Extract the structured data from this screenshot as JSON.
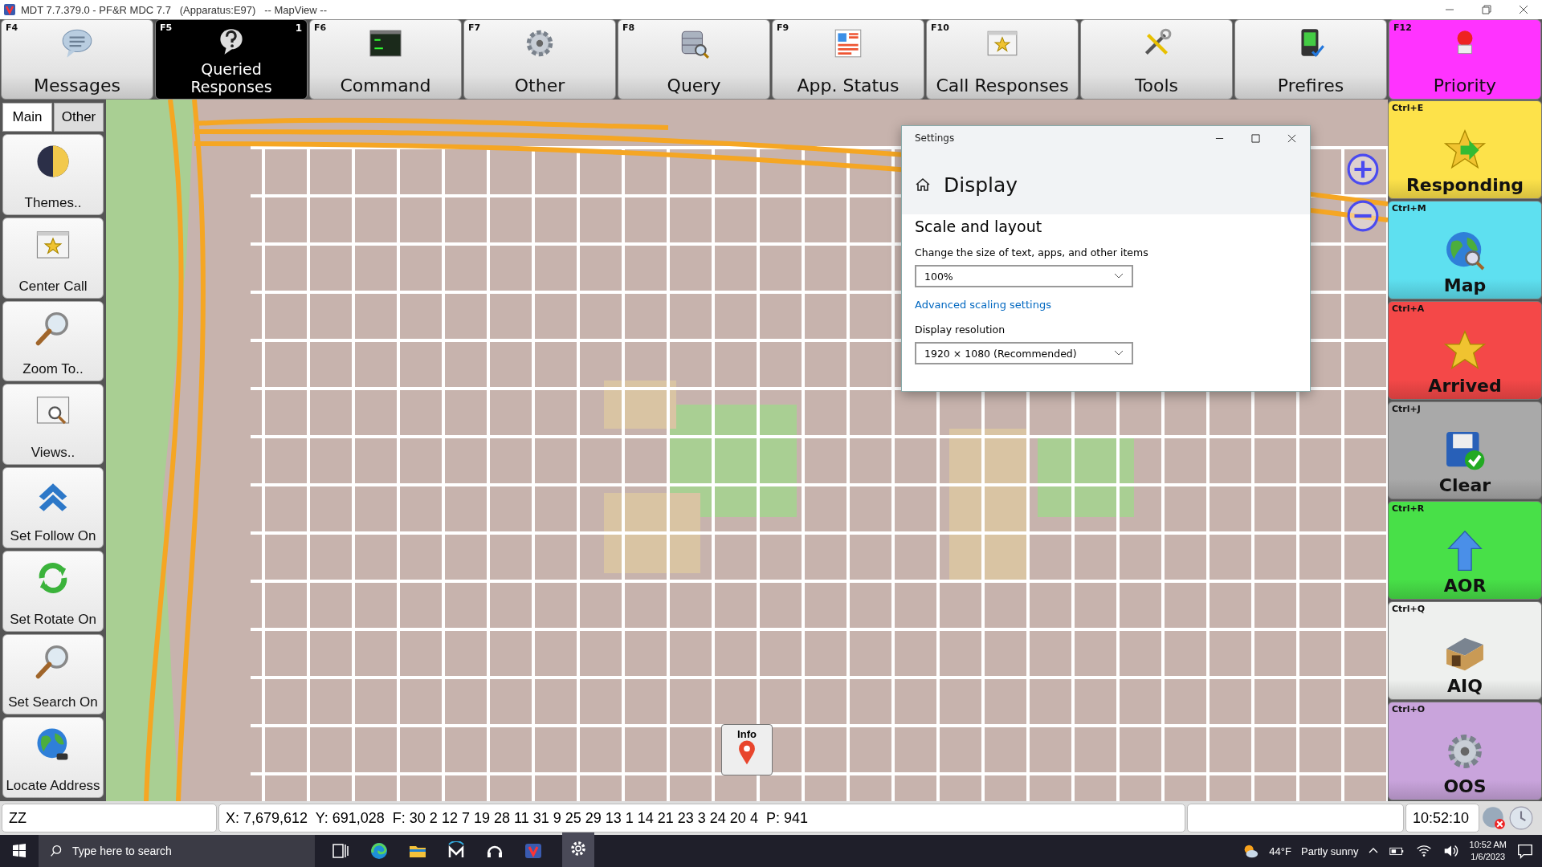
{
  "window": {
    "title": "MDT 7.7.379.0 - PF&R MDC 7.7   (Apparatus:E97)   -- MapView --"
  },
  "toolbar": [
    {
      "key": "F4",
      "label": "Messages",
      "selected": false,
      "kind": "normal"
    },
    {
      "key": "F5",
      "label": "Queried Responses",
      "selected": true,
      "kind": "normal",
      "badge": "1"
    },
    {
      "key": "F6",
      "label": "Command",
      "selected": false,
      "kind": "normal"
    },
    {
      "key": "F7",
      "label": "Other",
      "selected": false,
      "kind": "normal"
    },
    {
      "key": "F8",
      "label": "Query",
      "selected": false,
      "kind": "normal"
    },
    {
      "key": "F9",
      "label": "App. Status",
      "selected": false,
      "kind": "normal"
    },
    {
      "key": "F10",
      "label": "Call Responses",
      "selected": false,
      "kind": "normal"
    },
    {
      "label": "Tools",
      "selected": false,
      "kind": "normal"
    },
    {
      "label": "Prefires",
      "selected": false,
      "kind": "normal"
    },
    {
      "key": "F12",
      "label": "Priority",
      "selected": false,
      "kind": "alert"
    }
  ],
  "left_panel": {
    "tabs": [
      {
        "label": "Main",
        "selected": true
      },
      {
        "label": "Other",
        "selected": false
      }
    ],
    "buttons": [
      {
        "label": "Themes.."
      },
      {
        "label": "Center Call"
      },
      {
        "label": "Zoom To.."
      },
      {
        "label": "Views.."
      },
      {
        "label": "Set Follow On"
      },
      {
        "label": "Set Rotate On"
      },
      {
        "label": "Set Search On"
      },
      {
        "label": "Locate Address"
      }
    ]
  },
  "map": {
    "info_button": "Info"
  },
  "settings": {
    "title": "Settings",
    "heading": "Display",
    "section": "Scale and layout",
    "scale_label": "Change the size of text, apps, and other items",
    "scale_value": "100%",
    "link": "Advanced scaling settings",
    "resolution_label": "Display resolution",
    "resolution_value": "1920 × 1080 (Recommended)"
  },
  "status_buttons": [
    {
      "shortcut": "Ctrl+E",
      "label": "Responding",
      "color": "#fde24a"
    },
    {
      "shortcut": "Ctrl+M",
      "label": "Map",
      "color": "#5ee0f0"
    },
    {
      "shortcut": "Ctrl+A",
      "label": "Arrived",
      "color": "#f44848"
    },
    {
      "shortcut": "Ctrl+J",
      "label": "Clear",
      "color": "#a9a9a9"
    },
    {
      "shortcut": "Ctrl+R",
      "label": "AOR",
      "color": "#48e048"
    },
    {
      "shortcut": "Ctrl+Q",
      "label": "AIQ",
      "color": "#eef0ee"
    },
    {
      "shortcut": "Ctrl+O",
      "label": "OOS",
      "color": "#c9a4dc"
    }
  ],
  "status_bar": {
    "field_1": "ZZ",
    "coordinates": "X: 7,679,612  Y: 691,028  F: 30 2 12 7 19 28 11 31 9 25 29 13 1 14 21 23 3 24 20 4  P: 941",
    "clock": "10:52:10"
  },
  "taskbar": {
    "search_placeholder": "Type here to search",
    "temperature": "44°F",
    "weather": "Partly sunny",
    "time": "10:52 AM",
    "date": "1/6/2023"
  }
}
